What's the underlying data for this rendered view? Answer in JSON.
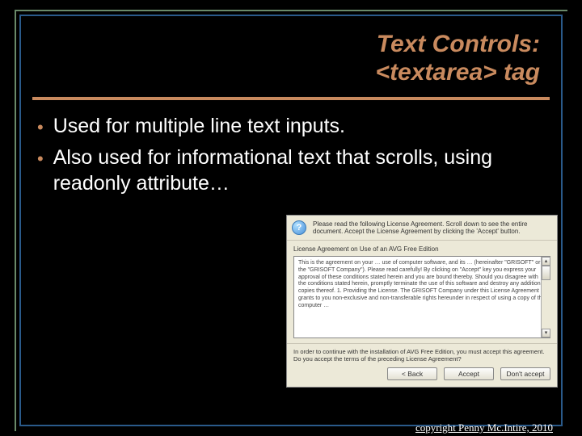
{
  "title": {
    "line1": "Text Controls:",
    "line2": "<textarea> tag"
  },
  "bullets": [
    "Used for multiple line text inputs.",
    "Also used for informational text that scrolls, using readonly attribute…"
  ],
  "dialog": {
    "instruction": "Please read the following License Agreement. Scroll down to see the entire document. Accept the License Agreement by clicking the 'Accept' button.",
    "license_heading": "License Agreement on Use of an AVG Free Edition",
    "license_body": "This is the agreement on your … use of computer software, and its … (hereinafter \"GRISOFT\" or the \"GRISOFT Company\"). Please read carefully! By clicking on \"Accept\" key you express your approval of these conditions stated herein and you are bound thereby.\n\nShould you disagree with the conditions stated herein, promptly terminate the use of this software and destroy any additional copies thereof.\n\n1. Providing the License. The GRISOFT Company under this License Agreement grants to you non-exclusive and non-transferable rights hereunder in respect of using a copy of the computer …",
    "question": "In order to continue with the installation of AVG Free Edition, you must accept this agreement. Do you accept the terms of the preceding License Agreement?",
    "btn_back": "< Back",
    "btn_accept": "Accept",
    "btn_decline": "Don't accept"
  },
  "copyright": "copyright Penny Mc.Intire, 2010"
}
